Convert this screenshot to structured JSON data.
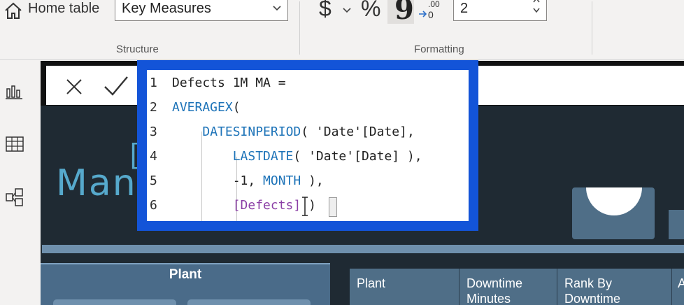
{
  "ribbon": {
    "structure": {
      "home_table_label": "Home table",
      "home_table_value": "Key Measures",
      "group_label": "Structure"
    },
    "formatting": {
      "currency_symbol": "$",
      "percent_symbol": "%",
      "comma_symbol": "9",
      "decimals_value": "2",
      "group_label": "Formatting"
    }
  },
  "rail": {
    "items": [
      {
        "icon": "report-view-icon"
      },
      {
        "icon": "data-view-icon"
      },
      {
        "icon": "model-view-icon"
      }
    ]
  },
  "formula": {
    "lines": [
      {
        "num": "1",
        "segments": [
          {
            "text": "Defects 1M MA =",
            "kind": "plain"
          }
        ]
      },
      {
        "num": "2",
        "segments": [
          {
            "text": "AVERAGEX",
            "kind": "fn"
          },
          {
            "text": "(",
            "kind": "plain"
          }
        ]
      },
      {
        "num": "3",
        "segments": [
          {
            "text": "    ",
            "kind": "plain"
          },
          {
            "text": "DATESINPERIOD",
            "kind": "fn"
          },
          {
            "text": "( 'Date'[Date],",
            "kind": "plain"
          }
        ]
      },
      {
        "num": "4",
        "segments": [
          {
            "text": "        ",
            "kind": "plain"
          },
          {
            "text": "LASTDATE",
            "kind": "fn"
          },
          {
            "text": "( 'Date'[Date] ),",
            "kind": "plain"
          }
        ]
      },
      {
        "num": "5",
        "segments": [
          {
            "text": "        -1, ",
            "kind": "plain"
          },
          {
            "text": "MONTH",
            "kind": "kw"
          },
          {
            "text": " ),",
            "kind": "plain"
          }
        ]
      },
      {
        "num": "6",
        "segments": [
          {
            "text": "        ",
            "kind": "plain"
          },
          {
            "text": "[Defects]",
            "kind": "meas"
          },
          {
            "text": " )",
            "kind": "plain"
          }
        ]
      }
    ]
  },
  "report": {
    "title_fragment": "Man",
    "title_fragment2": "[",
    "plant_slicer": {
      "label": "Plant"
    },
    "table": {
      "headers": [
        "Plant",
        "Downtime Minutes",
        "Rank By Downtime",
        "A"
      ]
    }
  },
  "colors": {
    "editor_border": "#1354d8",
    "canvas_bg": "#1f2a33",
    "accent_blue": "#56a9cc",
    "function": "#1d73b8",
    "measure": "#8b3fa6"
  }
}
